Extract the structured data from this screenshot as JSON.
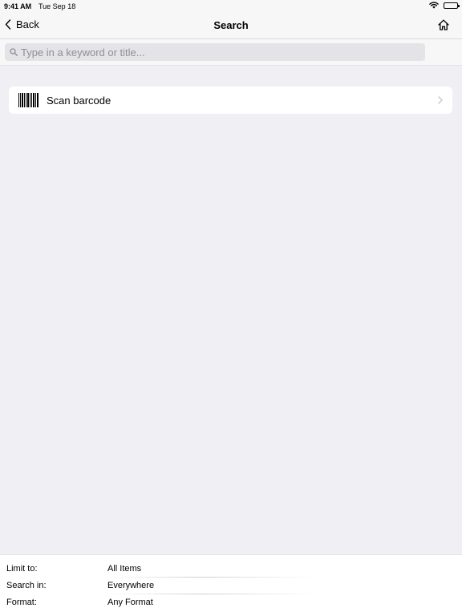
{
  "status_bar": {
    "time": "9:41 AM",
    "date": "Tue Sep 18",
    "icons": [
      "wifi-icon",
      "battery-icon"
    ]
  },
  "nav": {
    "back_label": "Back",
    "title": "Search",
    "icons": [
      "chevron-left-icon",
      "home-icon"
    ]
  },
  "search": {
    "placeholder": "Type in a keyword or title...",
    "value": "",
    "icon": "search-icon"
  },
  "actions": {
    "scan_label": "Scan barcode",
    "icons": [
      "barcode-icon",
      "chevron-right-icon"
    ]
  },
  "filters": [
    {
      "label": "Limit to:",
      "value": "All Items"
    },
    {
      "label": "Search in:",
      "value": "Everywhere"
    },
    {
      "label": "Format:",
      "value": "Any Format"
    }
  ],
  "colors": {
    "background": "#efeff4",
    "bar": "#f7f7f7",
    "search_field": "#e4e4e8",
    "placeholder": "#8e8e93",
    "chevron": "#c7c7cc"
  }
}
